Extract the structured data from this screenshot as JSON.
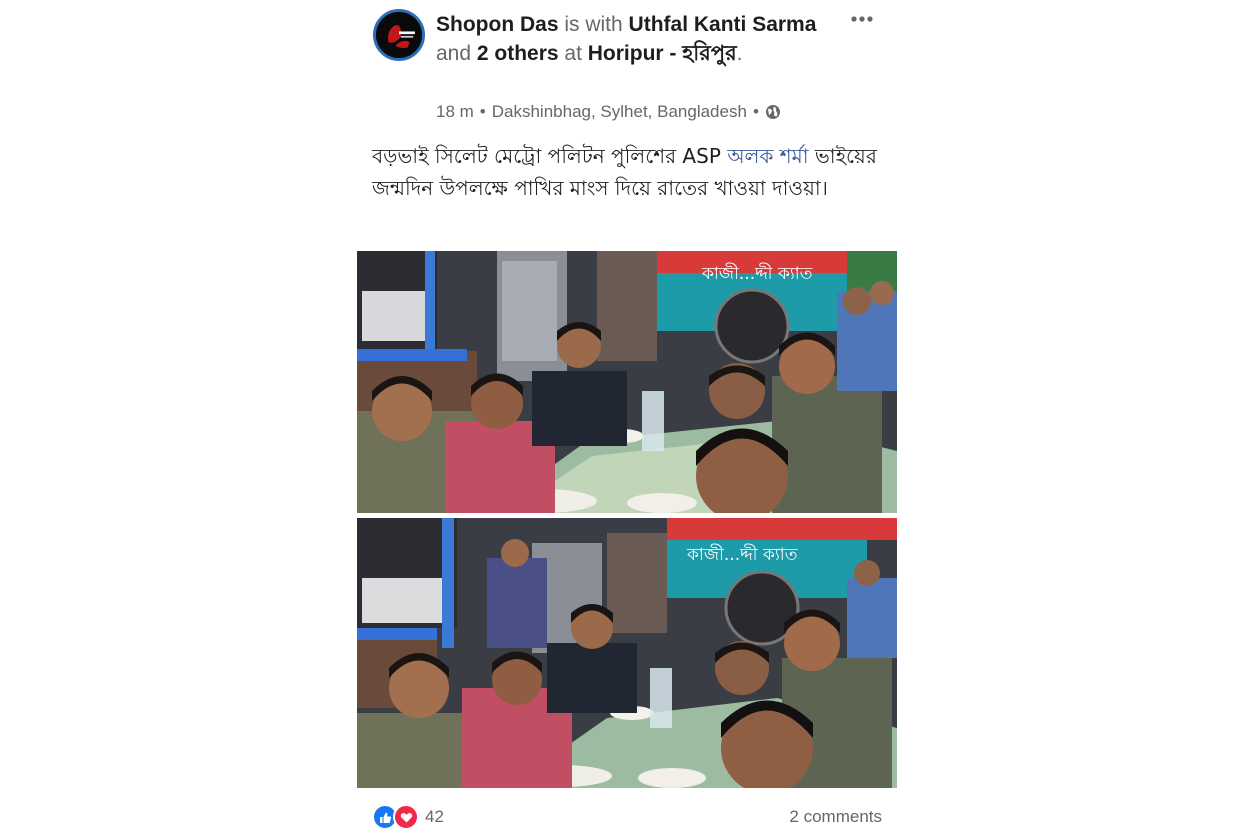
{
  "post": {
    "author": "Shopon Das",
    "with_text": " is with ",
    "tagged_person": "Uthfal Kanti Sarma",
    "and_text": " and ",
    "others": "2 others",
    "at_text": " at ",
    "place": "Horipur - হরিপুর",
    "period": ".",
    "time": "18 m",
    "separator": "•",
    "location": "Dakshinbhag, Sylhet, Bangladesh",
    "privacy_icon": "globe-icon",
    "caption_part1": "বড়ভাই সিলেট মেট্রো পলিটন পুলিশের ASP ",
    "caption_tag": "অলক শর্মা",
    "caption_part2": " ভাইয়ের জন্মদিন উপলক্ষে পাখির মাংস দিয়ে রাতের খাওয়া দাওয়া।",
    "photo_signs": [
      "কাজী...দ্দী ক্যাত",
      "কাজী...দ্দী ক্যাত"
    ]
  },
  "footer": {
    "reaction_icons": [
      "like-icon",
      "love-icon"
    ],
    "reaction_count": "42",
    "comments": "2 comments"
  },
  "colors": {
    "link": "#385898",
    "secondary_text": "#65676b",
    "like_blue": "#1877f2",
    "love_red": "#f0284a"
  }
}
